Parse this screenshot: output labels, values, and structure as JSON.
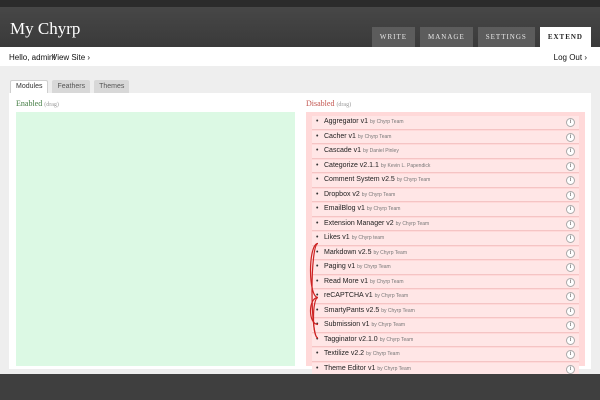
{
  "site": {
    "title": "My Chyrp"
  },
  "nav": {
    "tabs": [
      {
        "label": "WRITE"
      },
      {
        "label": "MANAGE"
      },
      {
        "label": "SETTINGS"
      },
      {
        "label": "EXTEND",
        "active": true
      }
    ]
  },
  "subbar": {
    "greeting": "Hello, admin!",
    "view_site": "View Site ›",
    "logout": "Log Out ›"
  },
  "tabs": [
    {
      "label": "Modules",
      "active": true
    },
    {
      "label": "Feathers"
    },
    {
      "label": "Themes"
    }
  ],
  "enabled": {
    "title": "Enabled",
    "hint": "(drag)"
  },
  "disabled": {
    "title": "Disabled",
    "hint": "(drag)",
    "modules": [
      {
        "name": "Aggregator v1",
        "author": "by Chyrp Team"
      },
      {
        "name": "Cacher v1",
        "author": "by Chyrp Team"
      },
      {
        "name": "Cascade v1",
        "author": "by Daniel Pinley"
      },
      {
        "name": "Categorize v2.1.1",
        "author": "by Kevin L. Papendick"
      },
      {
        "name": "Comment System v2.5",
        "author": "by Chyrp Team"
      },
      {
        "name": "Dropbox v2",
        "author": "by Chyrp Team"
      },
      {
        "name": "EmailBlog v1",
        "author": "by Chyrp Team"
      },
      {
        "name": "Extension Manager v2",
        "author": "by Chyrp Team"
      },
      {
        "name": "Likes v1",
        "author": "by Chyrp team"
      },
      {
        "name": "Markdown v2.5",
        "author": "by Chyrp Team"
      },
      {
        "name": "Paging v1",
        "author": "by Chyrp Team"
      },
      {
        "name": "Read More v1",
        "author": "by Chyrp Team"
      },
      {
        "name": "reCAPTCHA v1",
        "author": "by Chyrp Team"
      },
      {
        "name": "SmartyPants v2.5",
        "author": "by Chyrp Team"
      },
      {
        "name": "Submission v1",
        "author": "by Chyrp Team"
      },
      {
        "name": "Tagginator v2.1.0",
        "author": "by Chyrp Team"
      },
      {
        "name": "Textilize v2.2",
        "author": "by Chyrp Team"
      },
      {
        "name": "Theme Editor v1",
        "author": "by Chyrp Team"
      }
    ]
  },
  "colors": {
    "enabled_area": "#dcf9e4",
    "disabled_area": "#ffd9d9",
    "conflict_line": "#cc2222"
  },
  "icons": {
    "module_info": "info-icon"
  }
}
